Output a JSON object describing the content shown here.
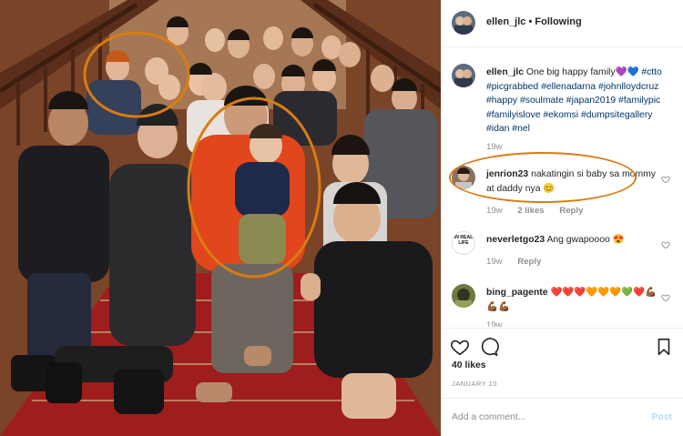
{
  "post": {
    "header": {
      "username": "ellen_jlc",
      "separator": "•",
      "follow_status": "Following"
    },
    "caption": {
      "username": "ellen_jlc",
      "text": "One big happy family",
      "emoji": "💜💙",
      "hashtags": "#ctto #picgrabbed #ellenadarna #johnlloydcruz #happy #soulmate #japan2019 #familypic #familyislove #ekomsi #dumpsitegallery #idan #nel",
      "age": "19w"
    },
    "comments": [
      {
        "username": "jenrion23",
        "text": "nakatingin si baby sa mommy at daddy nya",
        "emoji": "😊",
        "age": "19w",
        "likes": "2 likes",
        "reply_label": "Reply"
      },
      {
        "username": "neverletgo23",
        "avatar_text": "IN REAL LIFE",
        "text": "Ang gwapoooo",
        "emoji": "😍",
        "age": "19w",
        "reply_label": "Reply"
      },
      {
        "username": "bing_pagente",
        "text": "❤️❤️❤️🧡🧡🧡💚❤️💪🏾💪🏾💪🏾",
        "age": "19w"
      }
    ],
    "likes": "40 likes",
    "date": "JANUARY 10",
    "add_comment_placeholder": "Add a comment...",
    "post_button": "Post"
  },
  "icons": {
    "heart": "heart-outline-icon",
    "comment": "comment-bubble-icon",
    "bookmark": "bookmark-icon"
  },
  "colors": {
    "highlight_ring": "#d97c12",
    "link": "#003569",
    "muted": "#8e8e8e",
    "post_disabled": "#b3dbff"
  }
}
